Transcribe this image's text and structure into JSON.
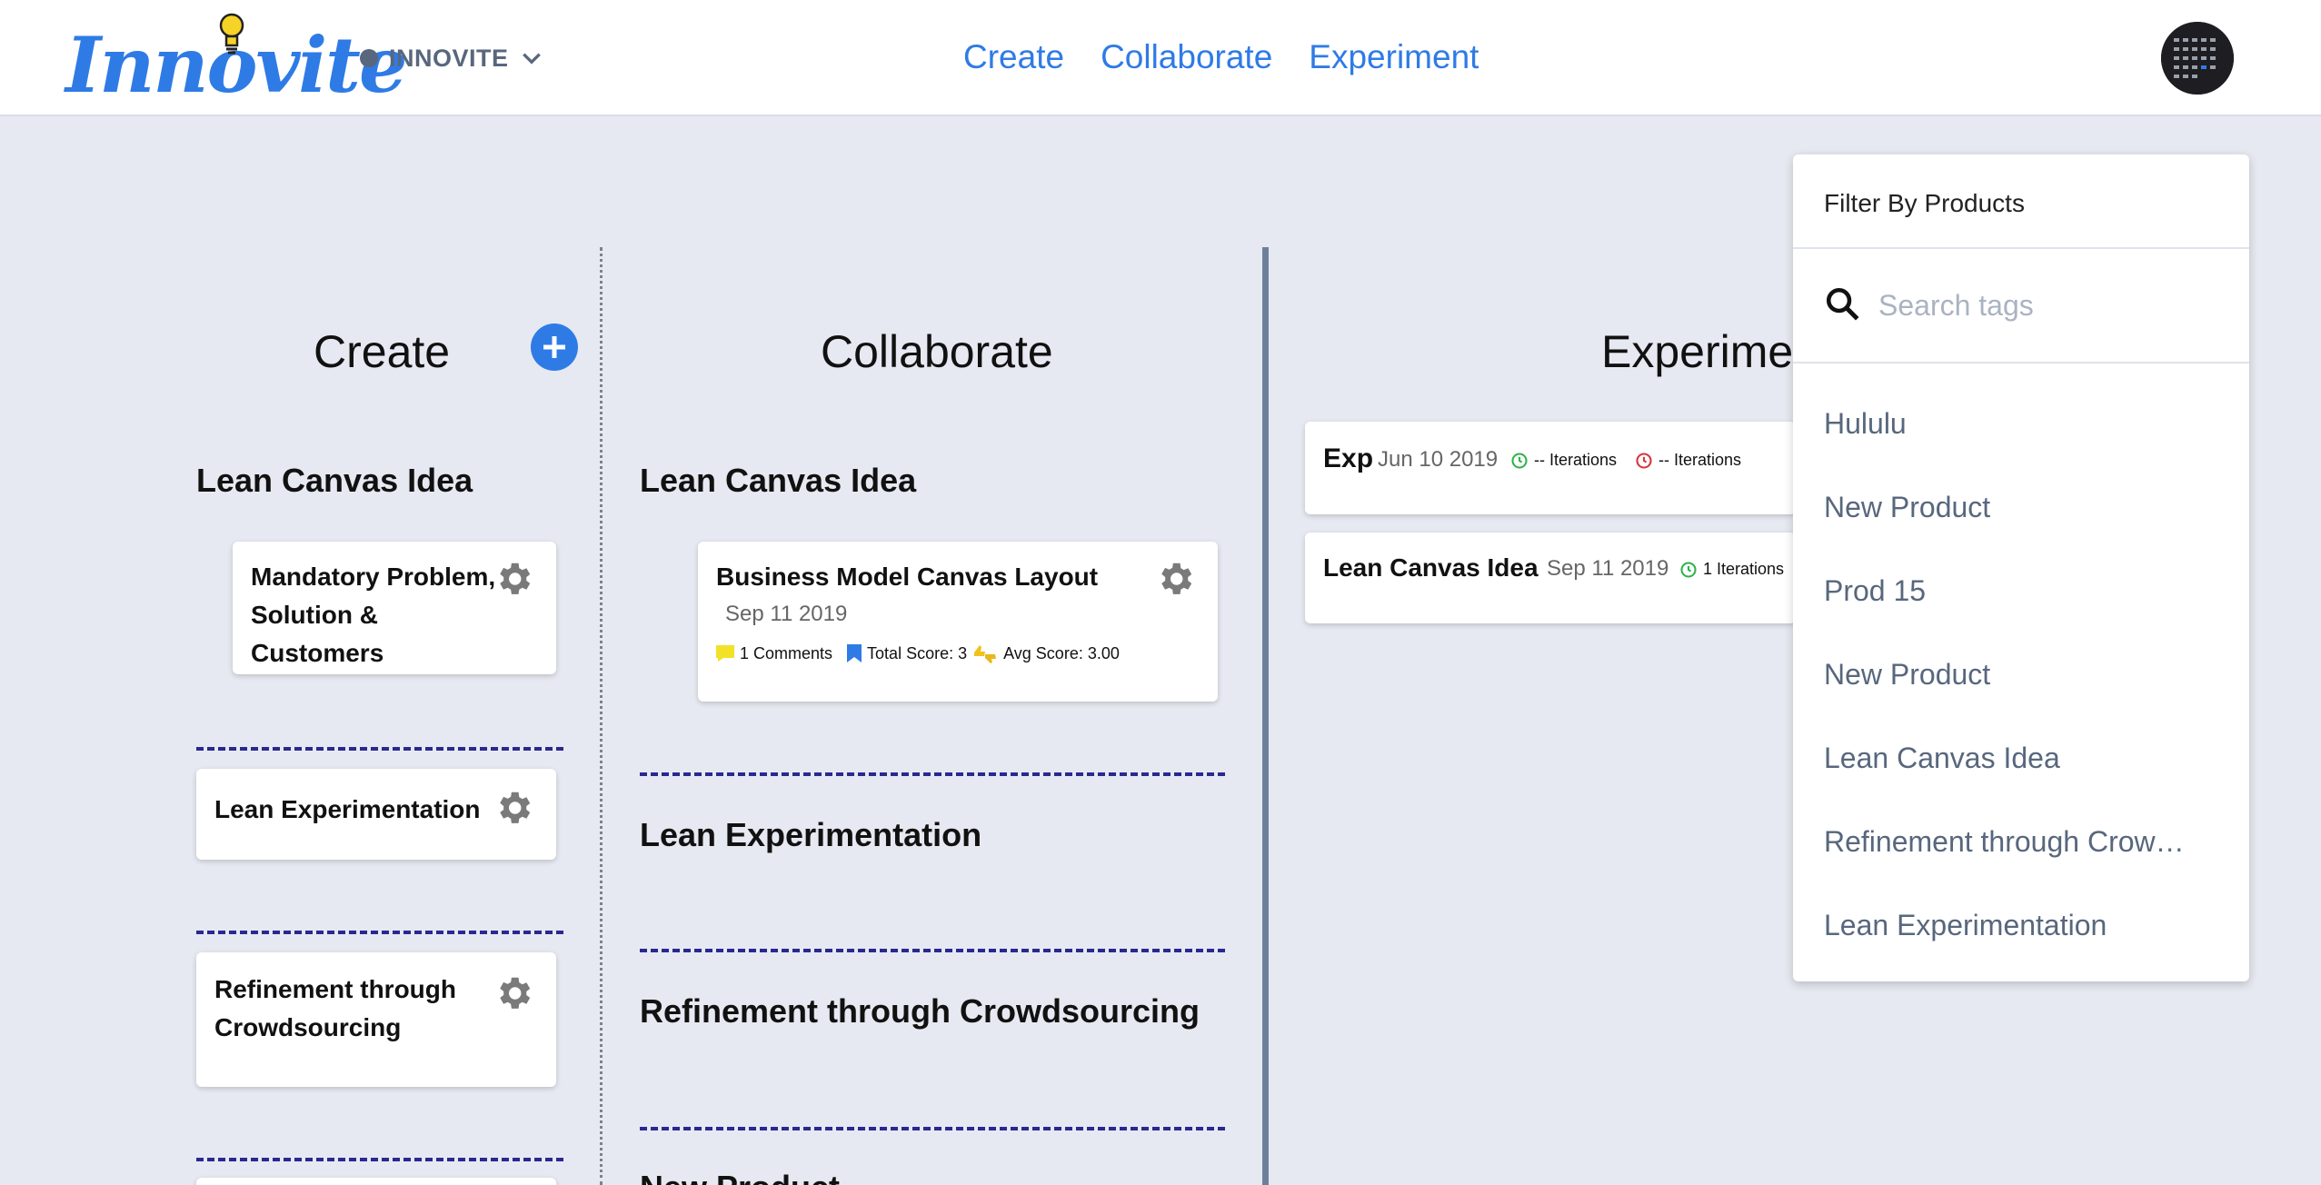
{
  "header": {
    "logo_text": "Innovite",
    "workspace": "INNOVITE",
    "nav": [
      "Create",
      "Collaborate",
      "Experiment"
    ]
  },
  "columns": {
    "create": {
      "title": "Create",
      "sections": [
        {
          "title": "Lean Canvas Idea",
          "card": "Mandatory Problem, Solution & Customers"
        },
        {
          "card": "Lean Experimentation"
        },
        {
          "card": "Refinement through Crowdsourcing"
        }
      ]
    },
    "collaborate": {
      "title": "Collaborate",
      "section1_title": "Lean Canvas Idea",
      "card": {
        "title": "Business Model Canvas Layout",
        "date": "Sep 11 2019",
        "comments": "1 Comments",
        "total_score": "Total Score: 3",
        "avg_score": "Avg Score: 3.00"
      },
      "section2_title": "Lean Experimentation",
      "section3_title": "Refinement through Crowdsourcing",
      "section4_title": "New Product"
    },
    "experiment": {
      "title": "Experiment",
      "cards": [
        {
          "title": "Exp",
          "date": "Jun 10 2019",
          "iter1": "-- Iterations",
          "iter2": "-- Iterations"
        },
        {
          "title": "Lean Canvas Idea",
          "date": "Sep 11 2019",
          "iter1": "1 Iterations"
        }
      ]
    }
  },
  "filter": {
    "title": "Filter By Products",
    "search_placeholder": "Search tags",
    "items": [
      "Hululu",
      "New Product",
      "Prod 15",
      "New Product",
      "Lean Canvas Idea",
      "Refinement through Crow…",
      "Lean Experimentation"
    ]
  },
  "colors": {
    "accent": "#2f7be6",
    "background": "#e6e9f1",
    "dash": "#2a2891",
    "muted": "#58677d"
  }
}
